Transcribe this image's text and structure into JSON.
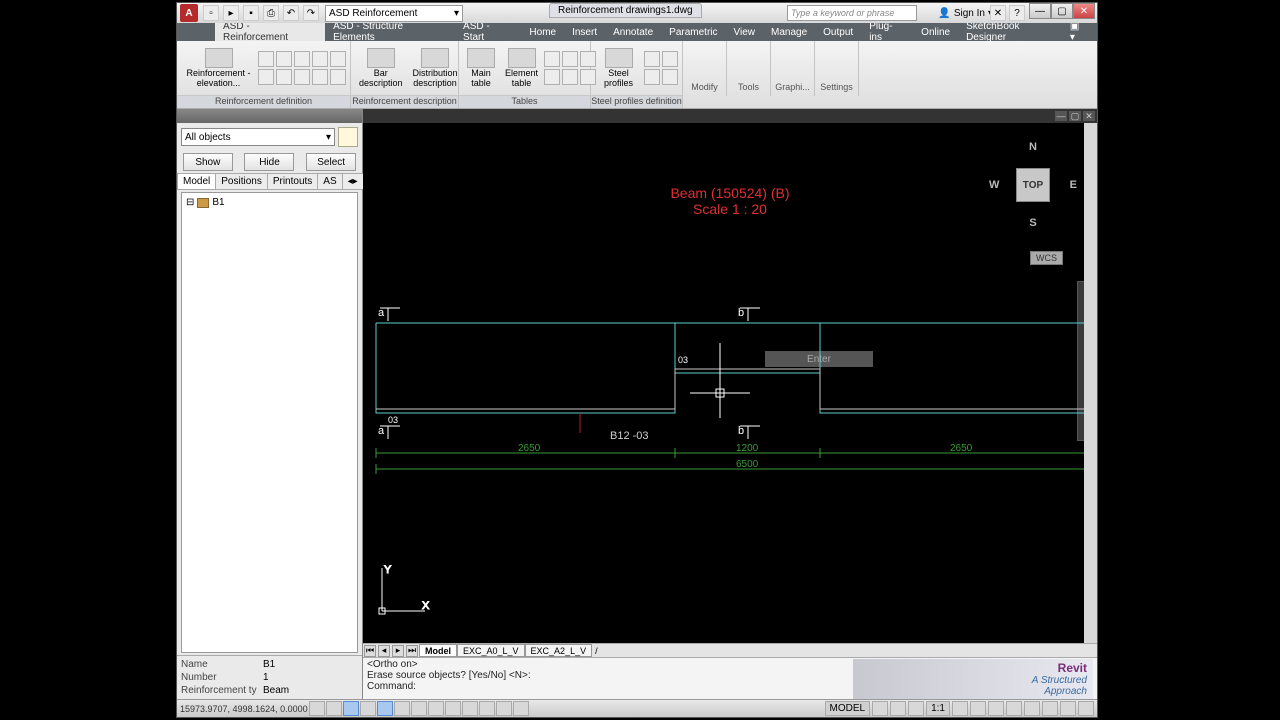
{
  "titlebar": {
    "layer_combo": "ASD Reinforcement",
    "doc_name": "Reinforcement drawings1.dwg",
    "search_placeholder": "Type a keyword or phrase",
    "signin": "Sign In"
  },
  "win": {
    "min": "—",
    "max": "▢",
    "close": "✕"
  },
  "ribbon_tabs": [
    "ASD - Reinforcement",
    "ASD - Structure Elements",
    "ASD - Start",
    "Home",
    "Insert",
    "Annotate",
    "Parametric",
    "View",
    "Manage",
    "Output",
    "Plug-ins",
    "Online",
    "SketchBook Designer"
  ],
  "ribbon": {
    "g1": {
      "big": "Reinforcement - elevation...",
      "label": "Reinforcement definition"
    },
    "g2": {
      "big1": "Bar description",
      "big2": "Distribution description",
      "label": "Reinforcement description"
    },
    "g3": {
      "big1": "Main table",
      "big2": "Element table",
      "label": "Tables"
    },
    "g4": {
      "big": "Steel profiles",
      "label": "Steel profiles definition"
    },
    "tabs": [
      "Modify",
      "Tools",
      "Graphi...",
      "Settings"
    ]
  },
  "side": {
    "filter": "All objects",
    "buttons": {
      "show": "Show",
      "hide": "Hide",
      "select": "Select"
    },
    "tabs": [
      "Model",
      "Positions",
      "Printouts",
      "AS"
    ],
    "tree_item": "B1",
    "props": {
      "name_label": "Name",
      "name_val": "B1",
      "num_label": "Number",
      "num_val": "1",
      "type_label": "Reinforcement ty",
      "type_val": "Beam"
    }
  },
  "drawing": {
    "title1": "Beam (150524) (B)",
    "title2": "Scale 1 : 20",
    "cube": {
      "n": "N",
      "s": "S",
      "e": "E",
      "w": "W",
      "top": "TOP"
    },
    "wcs": "WCS",
    "enter": "Enter",
    "mark_a": "a",
    "mark_b": "b",
    "dim_03": "03",
    "bar_label": "B12 -03",
    "dim1": "2650",
    "dim2": "1200",
    "dim3": "2650",
    "dim_total": "6500",
    "axis_y": "Y",
    "axis_x": "X"
  },
  "layout_tabs": [
    "Model",
    "EXC_A0_L_V",
    "EXC_A2_L_V"
  ],
  "command": {
    "line1": "<Ortho on>",
    "line2": "Erase source objects? [Yes/No] <N>:",
    "line3": "Command:"
  },
  "ad": {
    "t1": "Revit",
    "t2": "A Structured",
    "t3": "Approach"
  },
  "status": {
    "coords": "15973.9707, 4998.1624, 0.0000",
    "model": "MODEL",
    "scale": "1:1"
  }
}
